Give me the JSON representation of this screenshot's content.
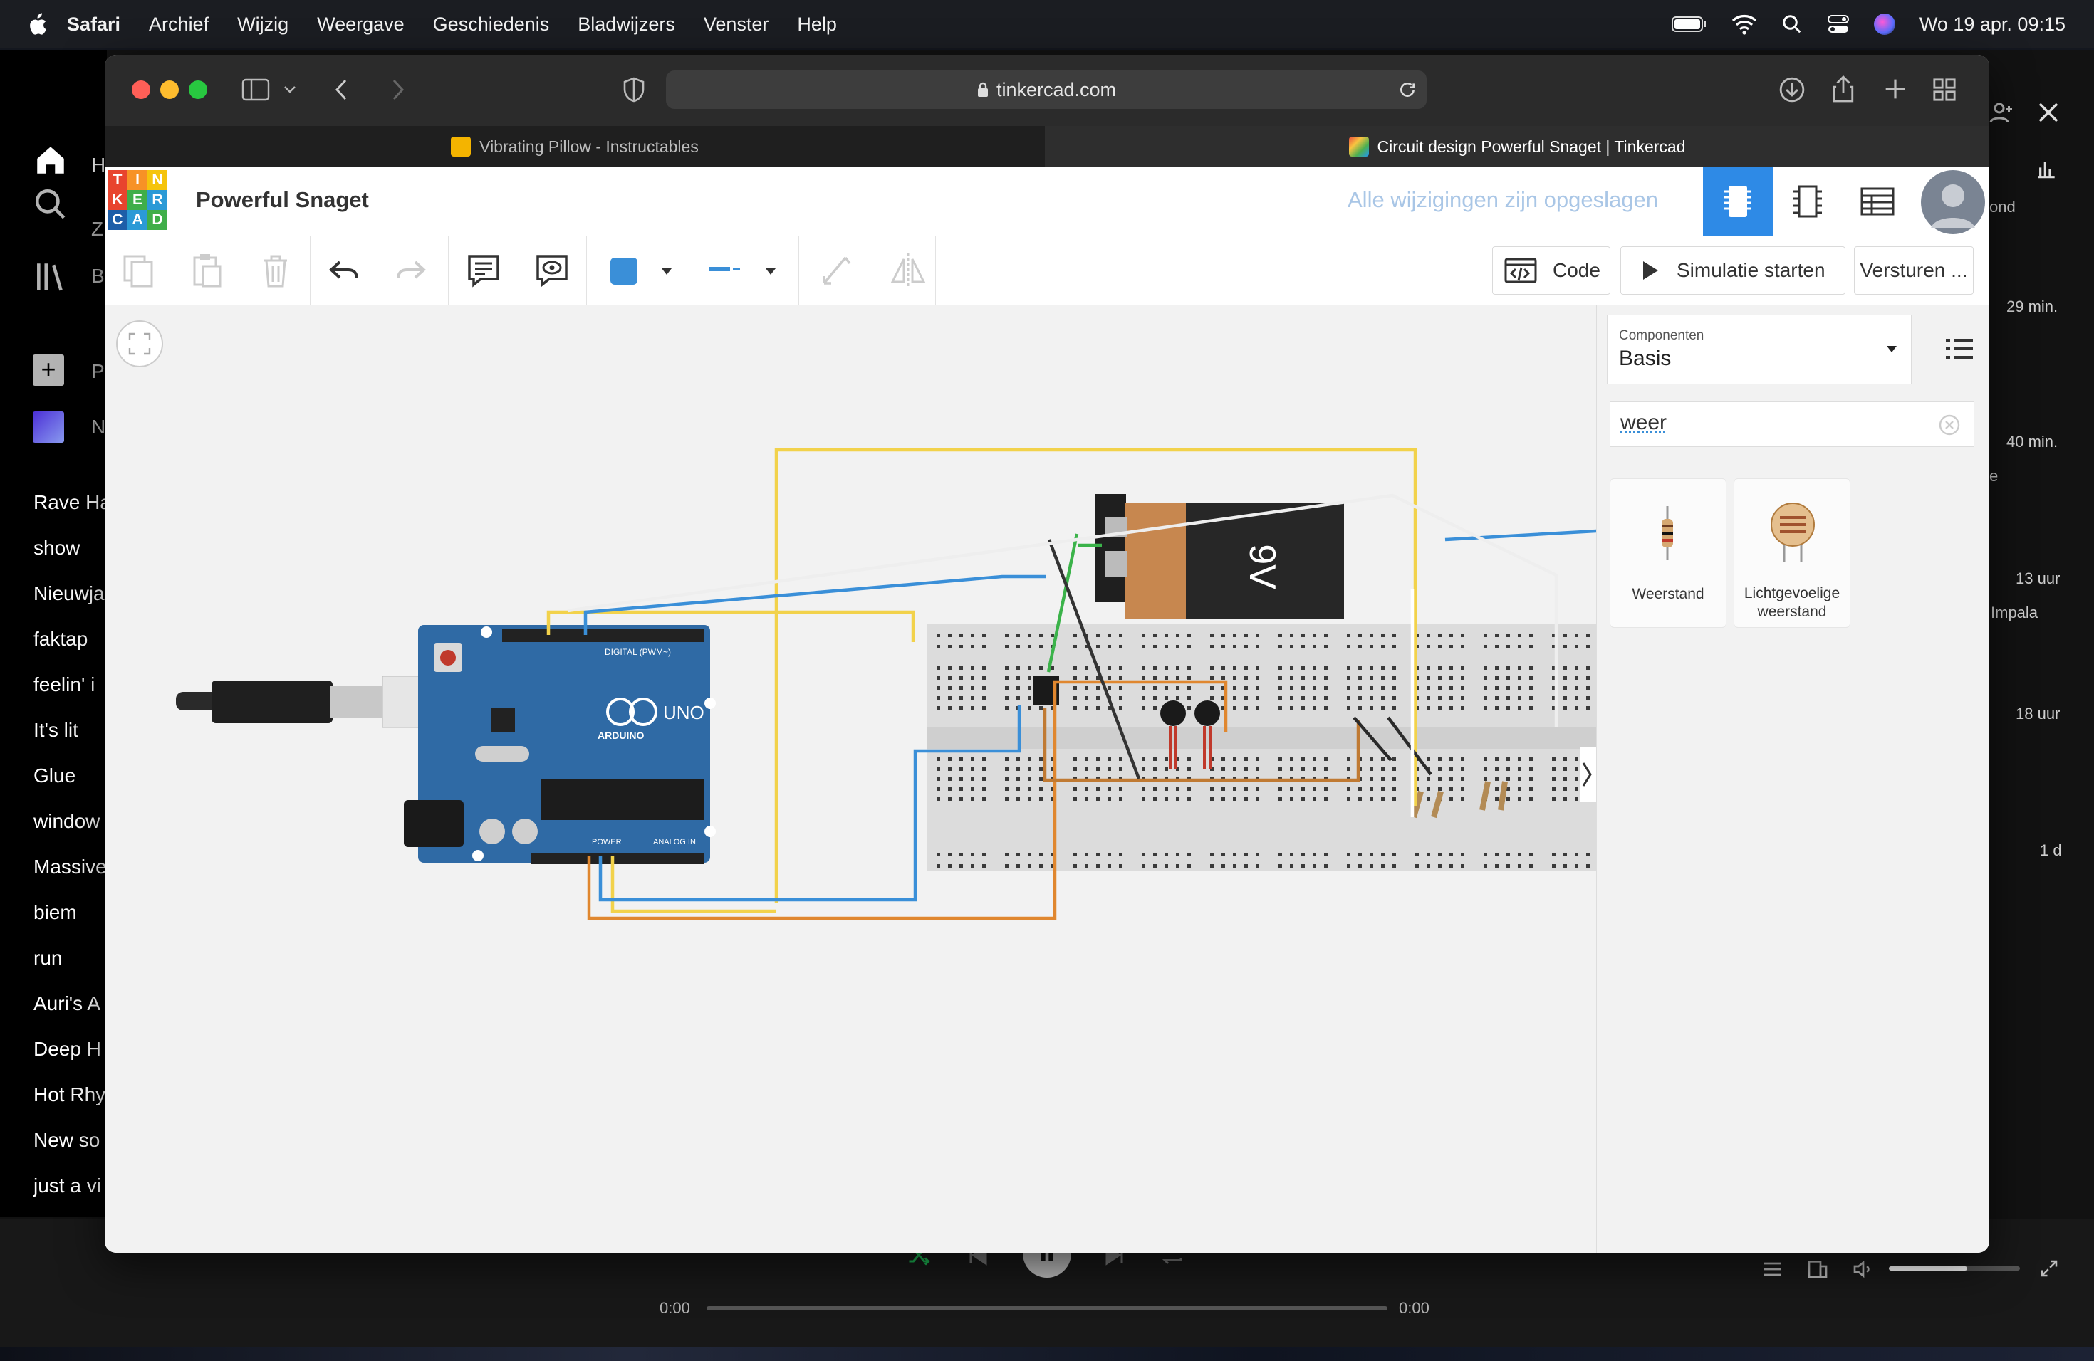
{
  "menubar": {
    "app": "Safari",
    "items": [
      "Archief",
      "Wijzig",
      "Weergave",
      "Geschiedenis",
      "Bladwijzers",
      "Venster",
      "Help"
    ],
    "clock": "Wo 19 apr. 09:15"
  },
  "music": {
    "nav": [
      "H",
      "Z",
      "B"
    ],
    "buttons": [
      "P",
      "N"
    ],
    "playlists": [
      "Rave Ha",
      "show",
      "Nieuwja",
      "faktap",
      "feelin' i",
      "It's lit",
      "Glue",
      "window",
      "Massive",
      "biem",
      "run",
      "Auri's A",
      "Deep H",
      "Hot Rhy",
      "New so",
      "just a vi"
    ],
    "right_col": [
      "ond",
      "29 min.",
      "40 min.",
      "e",
      "13 uur",
      "Impala",
      "18 uur",
      "1 d"
    ],
    "time_start": "0:00",
    "time_end": "0:00"
  },
  "browser": {
    "url": "tinkercad.com",
    "tabs": [
      {
        "label": "Vibrating Pillow - Instructables"
      },
      {
        "label": "Circuit design Powerful Snaget | Tinkercad"
      }
    ]
  },
  "tinkercad": {
    "logo": [
      "T",
      "I",
      "N",
      "K",
      "E",
      "R",
      "C",
      "A",
      "D"
    ],
    "project": "Powerful Snaget",
    "saved": "Alle wijzigingen zijn opgeslagen",
    "code_btn": "Code",
    "sim_btn": "Simulatie starten",
    "send_btn": "Versturen ...",
    "battery_label": "9V",
    "arduino_brand": "ARDUINO",
    "arduino_model": "UNO",
    "arduino_digital": "DIGITAL (PWM~)",
    "arduino_power": "POWER",
    "arduino_analog": "ANALOG IN",
    "panel": {
      "dropdown_label": "Componenten",
      "dropdown_value": "Basis",
      "search_value": "weer",
      "components": [
        {
          "name": "Weerstand"
        },
        {
          "name": "Lichtgevoelige weerstand"
        }
      ]
    }
  }
}
